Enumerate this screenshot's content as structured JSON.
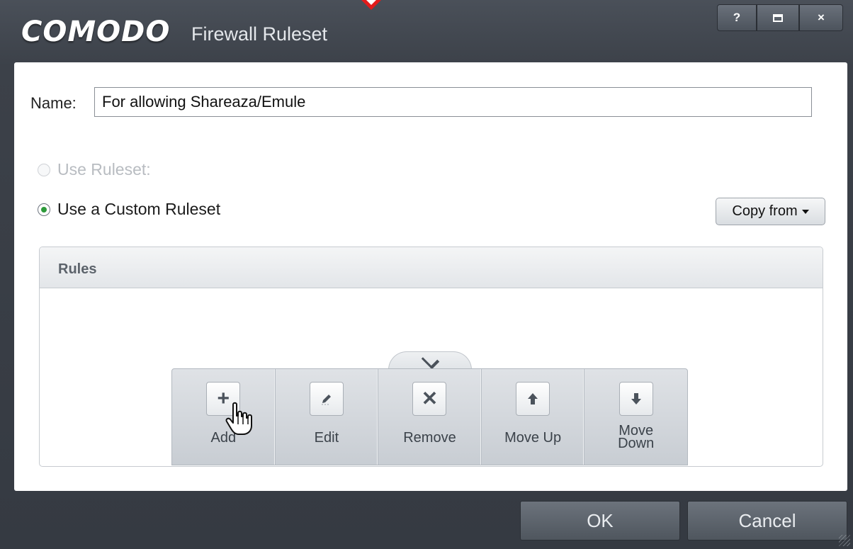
{
  "window": {
    "brand": "COMODO",
    "title": "Firewall Ruleset",
    "buttons": {
      "help": "?",
      "close": "×"
    }
  },
  "form": {
    "name_label": "Name:",
    "name_value": "For allowing Shareaza/Emule",
    "option_ruleset": "Use Ruleset:",
    "option_custom": "Use a Custom Ruleset",
    "copy_from": "Copy from"
  },
  "rules": {
    "heading": "Rules",
    "toolbar": [
      {
        "id": "add",
        "label": "Add",
        "icon": "plus-icon"
      },
      {
        "id": "edit",
        "label": "Edit",
        "icon": "pencil-icon"
      },
      {
        "id": "remove",
        "label": "Remove",
        "icon": "x-icon"
      },
      {
        "id": "move-up",
        "label": "Move Up",
        "icon": "arrow-up-icon"
      },
      {
        "id": "move-down",
        "label": "Move\nDown",
        "icon": "arrow-down-icon"
      }
    ]
  },
  "footer": {
    "ok": "OK",
    "cancel": "Cancel"
  },
  "colors": {
    "titlebar": "#3c4149",
    "accent_radio": "#2d9a3a",
    "annotation_arrow": "#e21b1b"
  }
}
